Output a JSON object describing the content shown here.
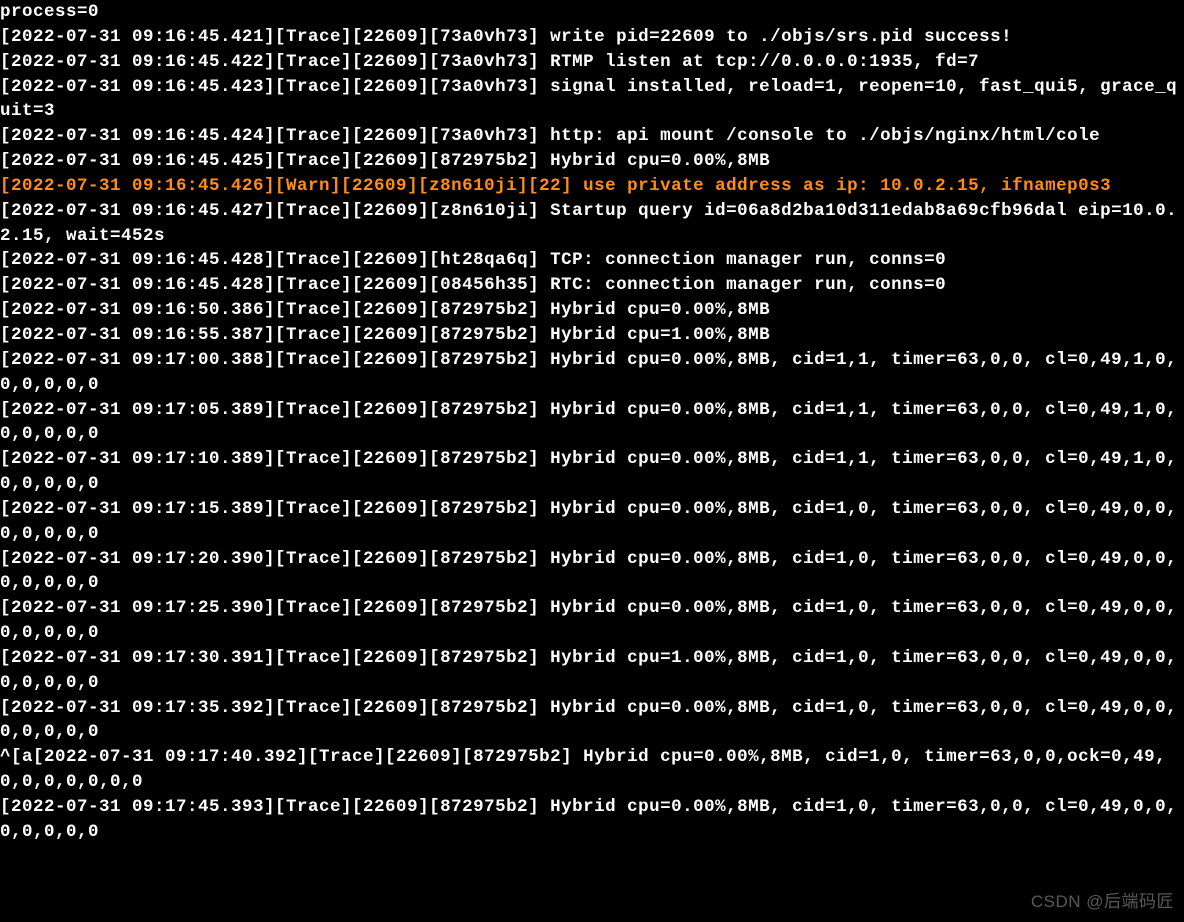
{
  "lines": [
    {
      "text": "process=0",
      "cls": "line"
    },
    {
      "text": "[2022-07-31 09:16:45.421][Trace][22609][73a0vh73] write pid=22609 to ./objs/srs.pid success!",
      "cls": "line"
    },
    {
      "text": "[2022-07-31 09:16:45.422][Trace][22609][73a0vh73] RTMP listen at tcp://0.0.0.0:1935, fd=7",
      "cls": "line"
    },
    {
      "text": "[2022-07-31 09:16:45.423][Trace][22609][73a0vh73] signal installed, reload=1, reopen=10, fast_qui5, grace_quit=3",
      "cls": "line-wrap"
    },
    {
      "text": "[2022-07-31 09:16:45.424][Trace][22609][73a0vh73] http: api mount /console to ./objs/nginx/html/cole",
      "cls": "line-wrap"
    },
    {
      "text": "[2022-07-31 09:16:45.425][Trace][22609][872975b2] Hybrid cpu=0.00%,8MB",
      "cls": "line"
    },
    {
      "text": "[2022-07-31 09:16:45.426][Warn][22609][z8n610ji][22] use private address as ip: 10.0.2.15, ifnamep0s3",
      "cls": "line-wrap warn"
    },
    {
      "text": "[2022-07-31 09:16:45.427][Trace][22609][z8n610ji] Startup query id=06a8d2ba10d311edab8a69cfb96dal eip=10.0.2.15, wait=452s",
      "cls": "line-wrap"
    },
    {
      "text": "[2022-07-31 09:16:45.428][Trace][22609][ht28qa6q] TCP: connection manager run, conns=0",
      "cls": "line"
    },
    {
      "text": "[2022-07-31 09:16:45.428][Trace][22609][08456h35] RTC: connection manager run, conns=0",
      "cls": "line"
    },
    {
      "text": "[2022-07-31 09:16:50.386][Trace][22609][872975b2] Hybrid cpu=0.00%,8MB",
      "cls": "line"
    },
    {
      "text": "[2022-07-31 09:16:55.387][Trace][22609][872975b2] Hybrid cpu=1.00%,8MB",
      "cls": "line"
    },
    {
      "text": "[2022-07-31 09:17:00.388][Trace][22609][872975b2] Hybrid cpu=0.00%,8MB, cid=1,1, timer=63,0,0, cl=0,49,1,0,0,0,0,0,0",
      "cls": "line-wrap"
    },
    {
      "text": "[2022-07-31 09:17:05.389][Trace][22609][872975b2] Hybrid cpu=0.00%,8MB, cid=1,1, timer=63,0,0, cl=0,49,1,0,0,0,0,0,0",
      "cls": "line-wrap"
    },
    {
      "text": "[2022-07-31 09:17:10.389][Trace][22609][872975b2] Hybrid cpu=0.00%,8MB, cid=1,1, timer=63,0,0, cl=0,49,1,0,0,0,0,0,0",
      "cls": "line-wrap"
    },
    {
      "text": "[2022-07-31 09:17:15.389][Trace][22609][872975b2] Hybrid cpu=0.00%,8MB, cid=1,0, timer=63,0,0, cl=0,49,0,0,0,0,0,0,0",
      "cls": "line-wrap"
    },
    {
      "text": "[2022-07-31 09:17:20.390][Trace][22609][872975b2] Hybrid cpu=0.00%,8MB, cid=1,0, timer=63,0,0, cl=0,49,0,0,0,0,0,0,0",
      "cls": "line-wrap"
    },
    {
      "text": "[2022-07-31 09:17:25.390][Trace][22609][872975b2] Hybrid cpu=0.00%,8MB, cid=1,0, timer=63,0,0, cl=0,49,0,0,0,0,0,0,0",
      "cls": "line-wrap"
    },
    {
      "text": "[2022-07-31 09:17:30.391][Trace][22609][872975b2] Hybrid cpu=1.00%,8MB, cid=1,0, timer=63,0,0, cl=0,49,0,0,0,0,0,0,0",
      "cls": "line-wrap"
    },
    {
      "text": "[2022-07-31 09:17:35.392][Trace][22609][872975b2] Hybrid cpu=0.00%,8MB, cid=1,0, timer=63,0,0, cl=0,49,0,0,0,0,0,0,0",
      "cls": "line-wrap"
    },
    {
      "text": "^[a[2022-07-31 09:17:40.392][Trace][22609][872975b2] Hybrid cpu=0.00%,8MB, cid=1,0, timer=63,0,0,ock=0,49,0,0,0,0,0,0,0",
      "cls": "line-wrap"
    },
    {
      "text": "[2022-07-31 09:17:45.393][Trace][22609][872975b2] Hybrid cpu=0.00%,8MB, cid=1,0, timer=63,0,0, cl=0,49,0,0,0,0,0,0,0",
      "cls": "line-wrap"
    }
  ],
  "watermark": "CSDN @后端码匠"
}
